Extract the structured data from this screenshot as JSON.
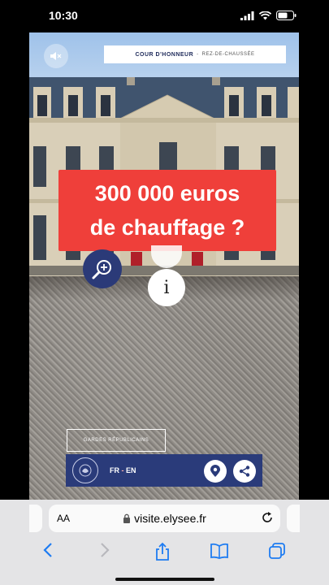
{
  "status_bar": {
    "time": "10:30"
  },
  "tour": {
    "location_title": "COUR D'HONNEUR",
    "location_separator": " - ",
    "location_floor": "REZ-DE-CHAUSSÉE",
    "headline_line1": "300 000 euros",
    "headline_line2": "de chauffage ?",
    "info_label": "i",
    "outline_button_label": "GARDES RÉPUBLICAINS",
    "lang_active": "FR",
    "lang_separator": " - ",
    "lang_other": "EN",
    "colors": {
      "headline_bg": "#ef3f3a",
      "navy": "#2a3b7a"
    }
  },
  "browser": {
    "text_size_label": "AA",
    "url": "visite.elysee.fr"
  }
}
